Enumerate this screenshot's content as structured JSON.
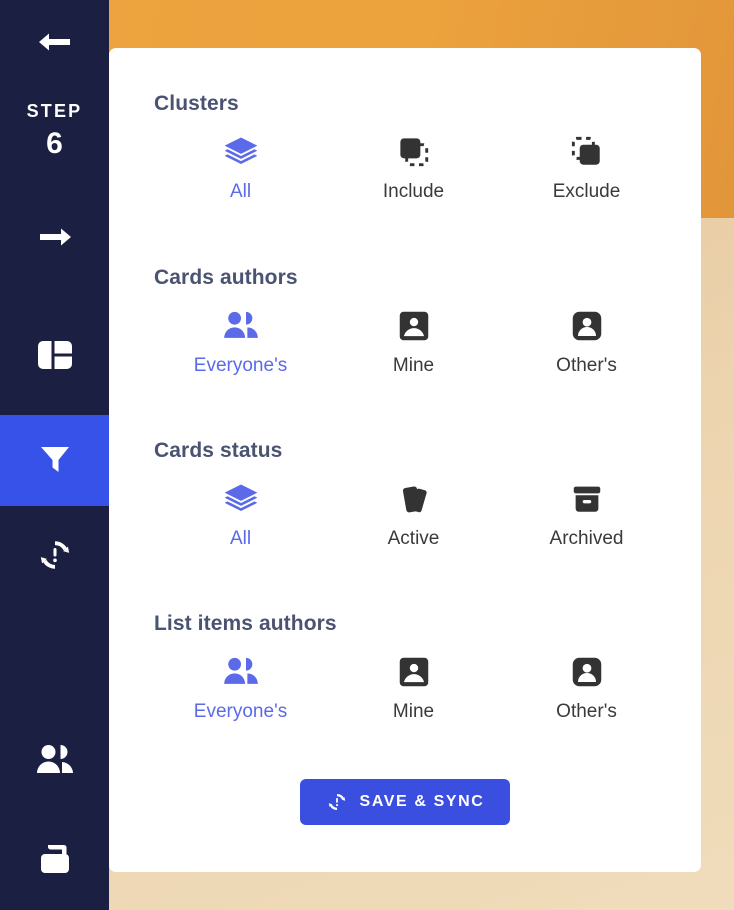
{
  "sidebar": {
    "back_label": "back-arrow",
    "step_word": "STEP",
    "step_number": "6",
    "forward_label": "forward-arrow",
    "items": [
      {
        "name": "layout",
        "label": "Board layout"
      },
      {
        "name": "filter",
        "label": "Filters",
        "active": true
      },
      {
        "name": "sync-alert",
        "label": "Sync"
      },
      {
        "name": "members",
        "label": "Members"
      },
      {
        "name": "workspace",
        "label": "Workspace"
      }
    ]
  },
  "panel": {
    "sections": [
      {
        "title": "Clusters",
        "options": [
          {
            "label": "All",
            "icon": "layers-icon",
            "selected": true
          },
          {
            "label": "Include",
            "icon": "include-square-icon",
            "selected": false
          },
          {
            "label": "Exclude",
            "icon": "exclude-square-icon",
            "selected": false
          }
        ]
      },
      {
        "title": "Cards authors",
        "options": [
          {
            "label": "Everyone's",
            "icon": "people-icon",
            "selected": true
          },
          {
            "label": "Mine",
            "icon": "portrait-card-icon",
            "selected": false
          },
          {
            "label": "Other's",
            "icon": "person-badge-icon",
            "selected": false
          }
        ]
      },
      {
        "title": "Cards status",
        "options": [
          {
            "label": "All",
            "icon": "layers-icon",
            "selected": true
          },
          {
            "label": "Active",
            "icon": "cards-icon",
            "selected": false
          },
          {
            "label": "Archived",
            "icon": "archive-box-icon",
            "selected": false
          }
        ]
      },
      {
        "title": "List items authors",
        "options": [
          {
            "label": "Everyone's",
            "icon": "people-icon",
            "selected": true
          },
          {
            "label": "Mine",
            "icon": "portrait-card-icon",
            "selected": false
          },
          {
            "label": "Other's",
            "icon": "person-badge-icon",
            "selected": false
          }
        ]
      }
    ],
    "save_button": {
      "label": "SAVE & SYNC",
      "icon": "sync-alert-icon"
    }
  },
  "colors": {
    "sidebar_bg": "#1b1f42",
    "sidebar_active": "#3752e8",
    "header_orange": "#eca23d",
    "body_tan": "#ecd4ae",
    "accent_indigo": "#5b6ae8",
    "button_blue": "#3a4fe0",
    "heading_slate": "#4b5372",
    "icon_dark": "#333333"
  }
}
